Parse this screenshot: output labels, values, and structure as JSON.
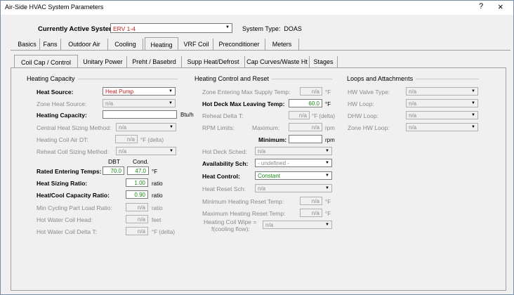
{
  "window": {
    "title": "Air-Side HVAC System Parameters",
    "help": "?",
    "close": "×"
  },
  "system": {
    "label": "Currently Active System:",
    "value": "ERV 1-4",
    "type_label": "System Type:",
    "type_value": "DOAS"
  },
  "tabs": [
    "Basics",
    "Fans",
    "Outdoor Air",
    "Cooling",
    "Heating",
    "VRF Coil",
    "Preconditioner",
    "Meters"
  ],
  "subtabs": [
    "Coil Cap / Control",
    "Unitary Power",
    "Preht / Basebrd",
    "Supp Heat/Defrost",
    "Cap Curves/Waste Ht",
    "Stages"
  ],
  "heating_capacity": {
    "title": "Heating Capacity",
    "heat_source_label": "Heat Source:",
    "heat_source_value": "Heat Pump",
    "zone_heat_source_label": "Zone Heat Source:",
    "zone_heat_source_value": "n/a",
    "heating_capacity_label": "Heating Capacity:",
    "heating_capacity_value": "",
    "heating_capacity_unit": "Btu/h",
    "central_sizing_label": "Central Heat Sizing Method:",
    "central_sizing_value": "n/a",
    "coil_air_dt_label": "Heating Coil Air DT:",
    "coil_air_dt_value": "n/a",
    "coil_air_dt_unit": "°F (delta)",
    "reheat_sizing_label": "Reheat Coil Sizing Method:",
    "reheat_sizing_value": "n/a",
    "dbt_header": "DBT",
    "cond_header": "Cond.",
    "rated_temps_label": "Rated Entering Temps:",
    "rated_dbt": "70.0",
    "rated_cond": "47.0",
    "rated_unit": "°F",
    "sizing_ratio_label": "Heat Sizing Ratio:",
    "sizing_ratio_value": "1.00",
    "sizing_ratio_unit": "ratio",
    "hc_ratio_label": "Heat/Cool Capacity Ratio:",
    "hc_ratio_value": "0.90",
    "hc_ratio_unit": "ratio",
    "min_cycling_label": "Min Cycling Part Load Ratio:",
    "min_cycling_value": "n/a",
    "min_cycling_unit": "ratio",
    "hw_head_label": "Hot Water Coil Head:",
    "hw_head_value": "n/a",
    "hw_head_unit": "feet",
    "hw_dt_label": "Hot Water Coil Delta T:",
    "hw_dt_value": "n/a",
    "hw_dt_unit": "°F (delta)"
  },
  "heating_control": {
    "title": "Heating Control and Reset",
    "zone_max_supply_label": "Zone Entering Max Supply Temp:",
    "zone_max_supply_value": "n/a",
    "zone_max_supply_unit": "°F",
    "hot_deck_max_label": "Hot Deck Max Leaving Temp:",
    "hot_deck_max_value": "60.0",
    "hot_deck_max_unit": "°F",
    "reheat_dt_label": "Reheat Delta T:",
    "reheat_dt_value": "n/a",
    "reheat_dt_unit": "°F (delta)",
    "rpm_label": "RPM Limits:",
    "rpm_max_label": "Maximum:",
    "rpm_max_value": "n/a",
    "rpm_max_unit": "rpm",
    "rpm_min_label": "Minimum:",
    "rpm_min_value": "",
    "rpm_min_unit": "rpm",
    "hot_deck_sched_label": "Hot Deck Sched:",
    "hot_deck_sched_value": "n/a",
    "availability_label": "Availability Sch:",
    "availability_value": "- undefined -",
    "heat_control_label": "Heat Control:",
    "heat_control_value": "Constant",
    "heat_reset_label": "Heat Reset Sch:",
    "heat_reset_value": "n/a",
    "min_reset_label": "Minimum Heating Reset Temp:",
    "min_reset_value": "n/a",
    "min_reset_unit": "°F",
    "max_reset_label": "Maximum Heating Reset Temp:",
    "max_reset_value": "n/a",
    "max_reset_unit": "°F",
    "wipe_label_1": "Heating Coil Wipe =",
    "wipe_label_2": "f(cooling flow):",
    "wipe_value": "n/a"
  },
  "loops": {
    "title": "Loops and Attachments",
    "hw_valve_label": "HW Valve Type:",
    "hw_valve_value": "n/a",
    "hw_loop_label": "HW Loop:",
    "hw_loop_value": "n/a",
    "dhw_loop_label": "DHW Loop:",
    "dhw_loop_value": "n/a",
    "zone_hw_loop_label": "Zone HW Loop:",
    "zone_hw_loop_value": "n/a"
  },
  "colors": {
    "accent_red": "#c81e1e",
    "value_green": "#1a8a1a",
    "disabled_grey": "#8a8a8a"
  }
}
